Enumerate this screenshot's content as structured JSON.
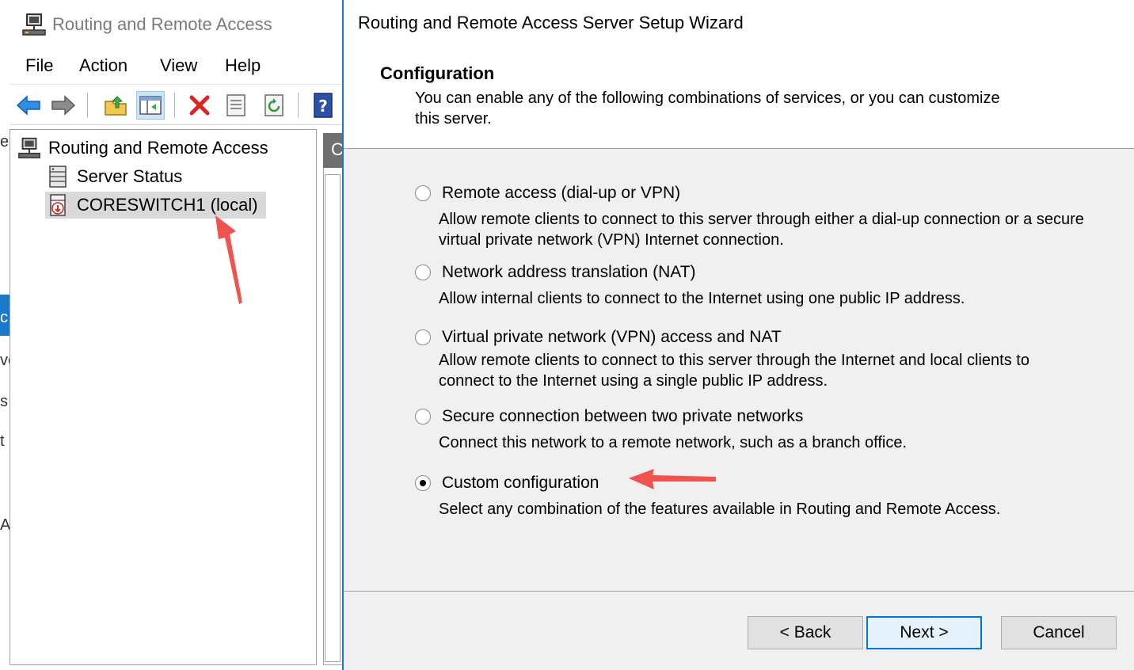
{
  "mmc": {
    "title": "Routing and Remote Access",
    "menu": [
      "File",
      "Action",
      "View",
      "Help"
    ],
    "toolbar": [
      "back-arrow-icon",
      "forward-arrow-icon",
      "up-folder-icon",
      "show-hide-console-tree-icon",
      "delete-icon",
      "properties-icon",
      "refresh-icon",
      "help-icon"
    ],
    "tree": {
      "root": "Routing and Remote Access",
      "server_status": "Server Status",
      "server": "CORESWITCH1 (local)"
    },
    "right_pane_header": "C",
    "background_fragments": [
      "e",
      "c",
      "ve",
      "s",
      "t",
      "Ac"
    ]
  },
  "wizard": {
    "title": "Routing and Remote Access Server Setup Wizard",
    "heading": "Configuration",
    "subtitle": "You can enable any of the following combinations of services, or you can customize this server.",
    "options": [
      {
        "label": "Remote access (dial-up or VPN)",
        "description": "Allow remote clients to connect to this server through either a dial-up connection or a secure virtual private network (VPN) Internet connection.",
        "checked": false
      },
      {
        "label": "Network address translation (NAT)",
        "description": "Allow internal clients to connect to the Internet using one public IP address.",
        "checked": false
      },
      {
        "label": "Virtual private network (VPN) access and NAT",
        "description": "Allow remote clients to connect to this server through the Internet and local clients to connect to the Internet using a single public IP address.",
        "checked": false
      },
      {
        "label": "Secure connection between two private networks",
        "description": "Connect this network to a remote network, such as a branch office.",
        "checked": false
      },
      {
        "label": "Custom configuration",
        "description": "Select any combination of the features available in Routing and Remote Access.",
        "checked": true
      }
    ],
    "buttons": {
      "back": "< Back",
      "next": "Next >",
      "cancel": "Cancel"
    }
  },
  "colors": {
    "accent": "#1979ca",
    "annotation_arrow": "#f0524f",
    "dialog_bg": "#f0f0f0",
    "selection_bg": "#d9d9d9"
  }
}
